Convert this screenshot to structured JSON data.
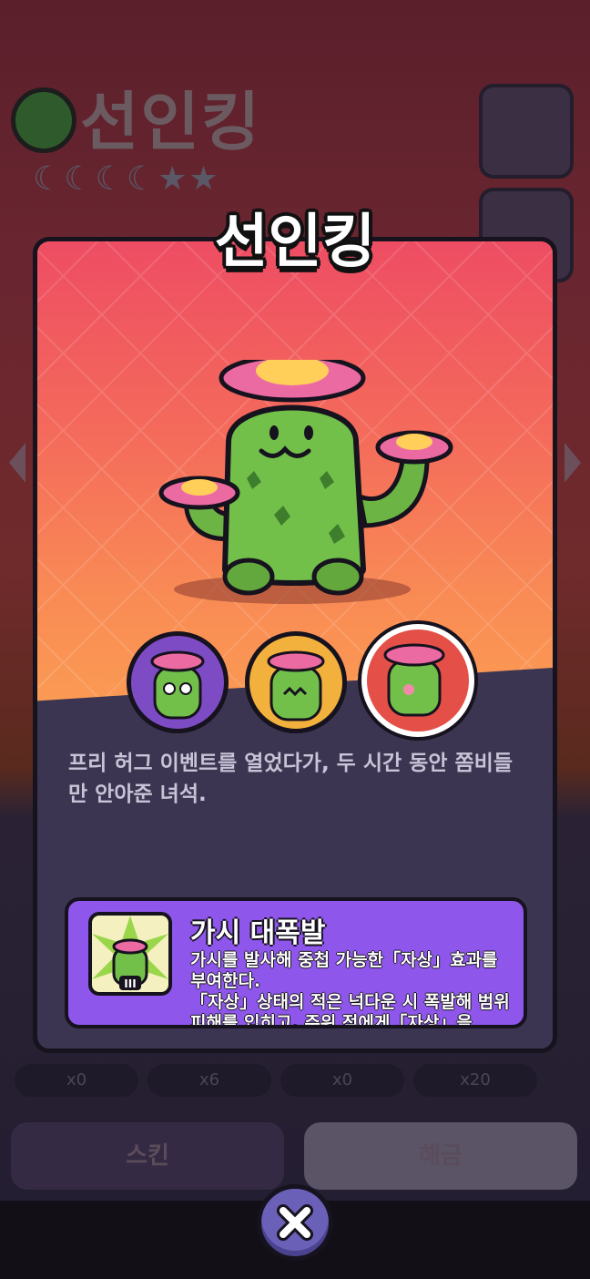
{
  "background": {
    "title": "선인킹",
    "moons": "☾☾☾☾★★",
    "counters": [
      "x0",
      "x6",
      "x0",
      "x20"
    ],
    "left_button_label": "스킨",
    "right_button_label": "해금"
  },
  "popup": {
    "title": "선인킹",
    "description": "프리 허그 이벤트를 열었다가, 두 시간 동안 쫌비들만 안아준 녀석.",
    "skins": [
      {
        "name": "skin-purple"
      },
      {
        "name": "skin-yellow"
      },
      {
        "name": "skin-red",
        "selected": true
      }
    ],
    "skill": {
      "title": "가시 대폭발",
      "level": "III",
      "text": "가시를 발사해 중첩 가능한「자상」효과를 부여한다.\n「자상」상태의 적은 넉다운 시 폭발해 범위 피해를 입히고, 주위 적에게「자상」을"
    },
    "close_icon": "close-icon"
  },
  "colors": {
    "art_top": "#ee4d63",
    "art_bottom": "#fb9c53",
    "panel": "#3b3552",
    "skill_bg": "#8e56ea",
    "close_bg": "#6a60b8"
  }
}
